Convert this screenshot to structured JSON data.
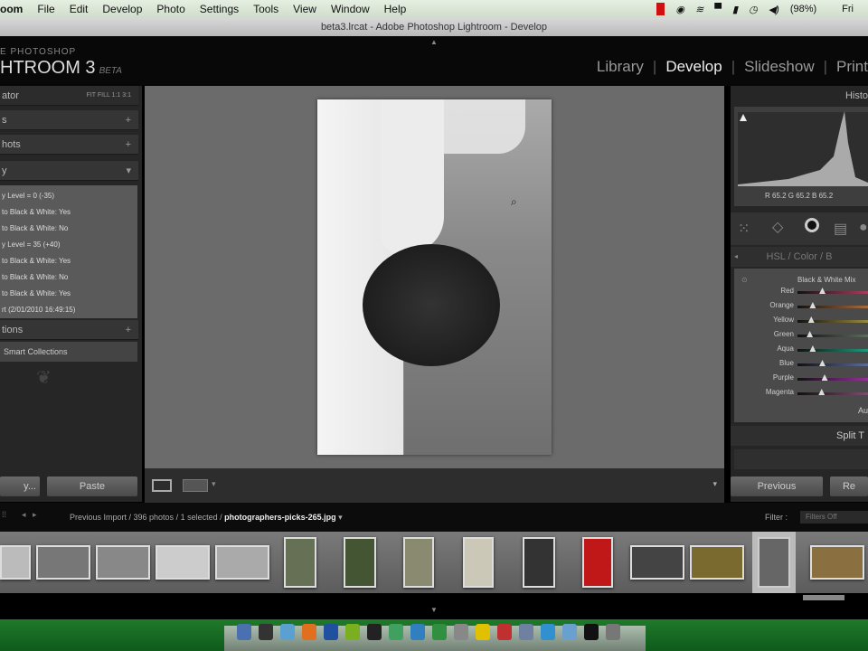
{
  "menubar": {
    "app": "oom",
    "items": [
      "File",
      "Edit",
      "Develop",
      "Photo",
      "Settings",
      "Tools",
      "View",
      "Window",
      "Help"
    ],
    "battery": "(98%)",
    "clock": "Fri"
  },
  "titlebar": {
    "title": "beta3.lrcat - Adobe Photoshop Lightroom - Develop"
  },
  "identity": {
    "line1": "E PHOTOSHOP",
    "line2": "HTROOM 3",
    "beta": "BETA"
  },
  "modules": {
    "items": [
      "Library",
      "Develop",
      "Slideshow",
      "Print"
    ],
    "active": "Develop",
    "sep": "|"
  },
  "left": {
    "navigator": {
      "label": "ator",
      "zoom": "FIT  FILL  1:1  3:1"
    },
    "presets": "s",
    "snapshots": "hots",
    "history": "y",
    "history_items": [
      "y Level = 0 (-35)",
      "to Black & White: Yes",
      "to Black & White: No",
      "y Level = 35 (+40)",
      "to Black & White: Yes",
      "to Black & White: No",
      "to Black & White: Yes",
      "rt (2/01/2010 16:49:15)"
    ],
    "collections": "tions",
    "smart_collections": "Smart Collections",
    "plus": "+",
    "copy": "y...",
    "paste": "Paste"
  },
  "right": {
    "histogram": "Histo",
    "rgb": "R 65.2  G 65.2  B 65.2",
    "hsl_header": "HSL / Color / B",
    "bw_mix": "Black & White Mix",
    "sliders": [
      {
        "label": "Red",
        "value": 0.33,
        "color": "#b04060"
      },
      {
        "label": "Orange",
        "value": 0.2,
        "color": "#b07040"
      },
      {
        "label": "Yellow",
        "value": 0.18,
        "color": "#a09040"
      },
      {
        "label": "Green",
        "value": 0.16,
        "color": "#607060"
      },
      {
        "label": "Aqua",
        "value": 0.2,
        "color": "#20a080"
      },
      {
        "label": "Blue",
        "value": 0.33,
        "color": "#6070a0"
      },
      {
        "label": "Purple",
        "value": 0.36,
        "color": "#a030a0"
      },
      {
        "label": "Magenta",
        "value": 0.32,
        "color": "#805070"
      }
    ],
    "auto": "Au",
    "split_toning": "Split T",
    "previous": "Previous",
    "reset": "Re"
  },
  "filmstrip": {
    "path": "Previous Import / 396 photos / 1 selected / ",
    "file": "photographers-picks-265.jpg",
    "filter_label": "Filter :",
    "filter_value": "Filters Off"
  }
}
